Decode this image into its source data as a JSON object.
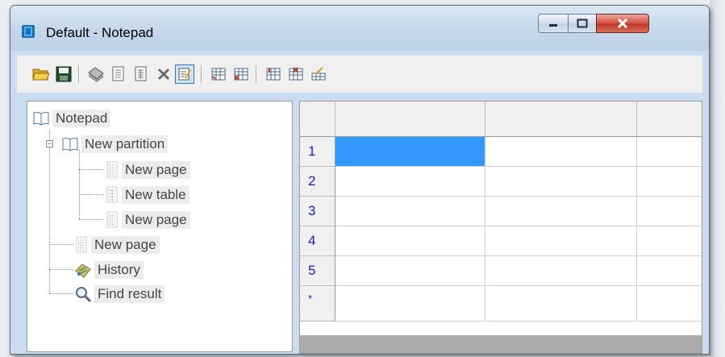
{
  "window": {
    "title": "Default - Notepad"
  },
  "titlebar_buttons": [
    {
      "name": "minimize-button",
      "icon": "minimize-icon"
    },
    {
      "name": "maximize-button",
      "icon": "maximize-icon"
    },
    {
      "name": "close-button",
      "icon": "close-icon",
      "color": "#c0392b"
    }
  ],
  "toolbar": {
    "buttons": [
      {
        "name": "open-button",
        "icon": "folder-open-icon"
      },
      {
        "name": "save-button",
        "icon": "floppy-disk-icon"
      },
      {
        "name": "new-partition-button",
        "icon": "notebook-stack-icon"
      },
      {
        "name": "new-page-button",
        "icon": "page-icon"
      },
      {
        "name": "new-table-button",
        "icon": "page-table-icon"
      },
      {
        "name": "delete-button",
        "icon": "delete-x-icon"
      },
      {
        "name": "edit-mode-button",
        "icon": "edit-page-icon",
        "active": true
      },
      {
        "name": "insert-row-button",
        "icon": "table-add-row-icon"
      },
      {
        "name": "delete-row-button",
        "icon": "table-delete-row-icon"
      },
      {
        "name": "insert-column-button",
        "icon": "table-add-column-icon"
      },
      {
        "name": "delete-column-button",
        "icon": "table-delete-column-icon"
      },
      {
        "name": "rename-column-button",
        "icon": "table-edit-icon"
      }
    ]
  },
  "tree": {
    "items": [
      {
        "label": "Notepad",
        "icon": "notebook-icon"
      },
      {
        "label": "New partition",
        "icon": "notebook-icon"
      },
      {
        "label": "New page",
        "icon": "page-icon"
      },
      {
        "label": "New table",
        "icon": "table-page-icon"
      },
      {
        "label": "New page",
        "icon": "page-icon"
      },
      {
        "label": "New page",
        "icon": "page-icon"
      },
      {
        "label": "History",
        "icon": "history-icon"
      },
      {
        "label": "Find result",
        "icon": "magnifier-icon"
      }
    ]
  },
  "grid": {
    "row_headers": [
      "1",
      "2",
      "3",
      "4",
      "5",
      "*"
    ],
    "selected_cell": {
      "row": 1,
      "column": 1
    },
    "selection_color": "#3399ff"
  }
}
